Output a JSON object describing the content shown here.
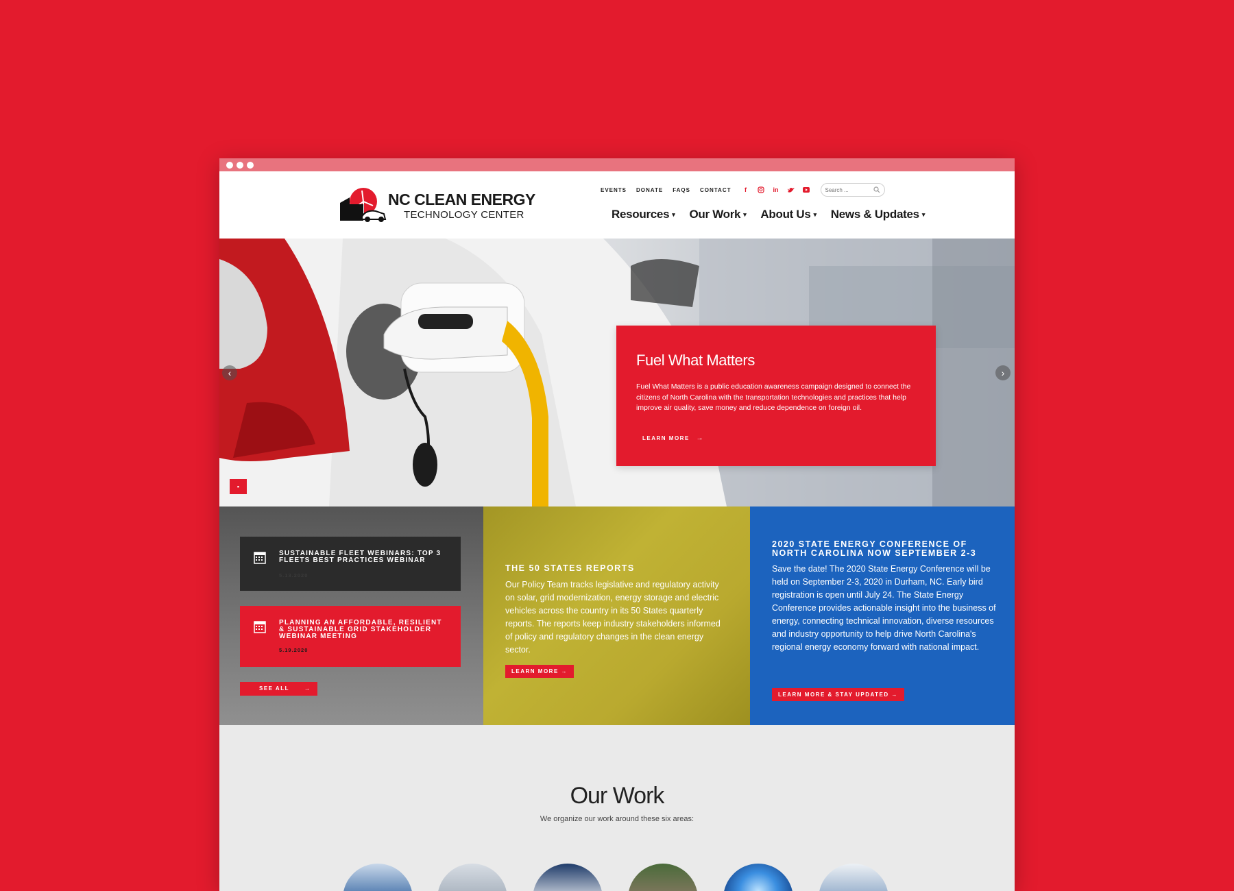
{
  "brand": {
    "line1": "NC CLEAN ENERGY",
    "line2": "TECHNOLOGY CENTER"
  },
  "utility_nav": [
    "EVENTS",
    "DONATE",
    "FAQS",
    "CONTACT"
  ],
  "social_icons": [
    "facebook-icon",
    "instagram-icon",
    "linkedin-icon",
    "twitter-icon",
    "youtube-icon"
  ],
  "search": {
    "placeholder": "Search ..."
  },
  "main_nav": [
    "Resources",
    "Our Work",
    "About Us",
    "News & Updates"
  ],
  "hero": {
    "title": "Fuel What Matters",
    "body": "Fuel What Matters is a public education awareness campaign designed to connect the citizens of North Carolina with the transportation technologies and practices that help improve air quality, save money and reduce dependence on foreign oil.",
    "link": "LEARN MORE"
  },
  "events": [
    {
      "title": "SUSTAINABLE FLEET WEBINARS: TOP 3 FLEETS BEST PRACTICES WEBINAR",
      "date": "5.13.2020"
    },
    {
      "title": "PLANNING AN AFFORDABLE, RESILIENT & SUSTAINABLE GRID STAKEHOLDER WEBINAR MEETING",
      "date": "5.19.2020"
    }
  ],
  "see_all": "SEE ALL",
  "reports": {
    "title": "THE 50 STATES REPORTS",
    "body": "Our Policy Team tracks legislative and regulatory activity on solar, grid modernization, energy storage and electric vehicles across the country in its 50 States quarterly reports. The reports keep industry stakeholders informed of policy and regulatory changes in the clean energy sector.",
    "button": "LEARN MORE"
  },
  "conference": {
    "title": "2020 STATE ENERGY CONFERENCE OF NORTH CAROLINA NOW SEPTEMBER 2-3",
    "body": "Save the date! The 2020 State Energy Conference will be held on September 2-3, 2020 in Durham, NC. Early bird registration is open until July 24. The State Energy Conference provides actionable insight into the business of energy, connecting technical innovation, diverse resources and industry opportunity to help drive North Carolina's regional energy economy forward with national impact.",
    "button": "LEARN MORE & STAY UPDATED"
  },
  "our_work": {
    "title": "Our Work",
    "subtitle": "We organize our work around these six areas:"
  },
  "colors": {
    "brand_red": "#e31b2d",
    "conference_blue": "#1c63be",
    "event_dark": "#2b2b2b"
  }
}
